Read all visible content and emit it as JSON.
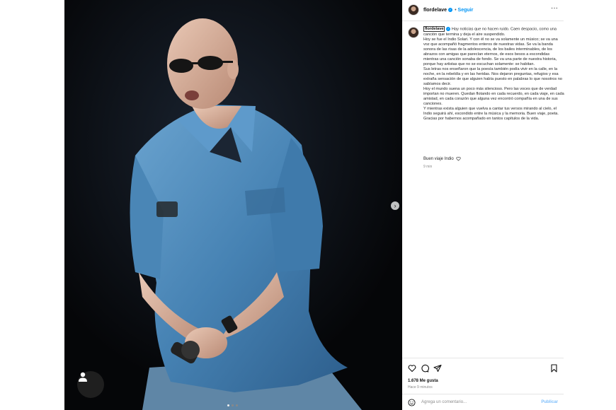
{
  "header": {
    "username": "flordelave",
    "separator": "•",
    "follow_label": "Seguir"
  },
  "caption": {
    "username": "flordelave",
    "paragraphs": [
      "Hay noticias que no hacen ruido. Caen despacio, como una canción que termina y deja el aire suspendido.",
      "Hoy se fue el Indio Solari. Y con él no se va solamente un músico; se va una voz que acompañó fragmentos enteros de nuestras vidas. Se va la banda sonora de las risas de la adolescencia, de los bailes interminables, de los abrazos con amigas que parecían eternos, de esos besos a escondidas mientras una canción sonaba de fondo. Se va una parte de nuestra historia, porque hay artistas que no se escuchan solamente: se habitan.",
      "Sus letras nos enseñaron que la poesía también podía vivir en la calle, en la noche, en la rebeldía y en las heridas. Nos dejaron preguntas, refugios y esa extraña sensación de que alguien había puesto en palabras lo que nosotros no sabíamos decir.",
      "Hoy el mundo suena un poco más silencioso. Pero las voces que de verdad importan no mueren. Quedan flotando en cada recuerdo, en cada viaje, en cada amistad, en cada corazón que alguna vez encontró compañía en una de sus canciones.",
      "Y mientras exista alguien que vuelva a cantar tus versos mirando al cielo, el Indio seguirá ahí, escondido entre la música y la memoria. Buen viaje, poeta. Gracias por habernos acompañado en tantos capítulos de la vida."
    ]
  },
  "comment": {
    "text": "Buen viaje Indio",
    "time": "9 min"
  },
  "stats": {
    "likes": "1.678 Me gusta",
    "ago": "Hace 9 minutos"
  },
  "composer": {
    "placeholder": "Agrega un comentario...",
    "publish_label": "Publicar"
  },
  "icons": [
    "more-icon",
    "heart-icon",
    "comment-icon",
    "share-icon",
    "bookmark-icon",
    "emoji-icon",
    "next-arrow-icon",
    "user-tag-icon"
  ],
  "colors": {
    "accent": "#0095f6",
    "publish": "#7fbffb",
    "photo_bg": "#07080b",
    "shirt": "#4a86b6"
  }
}
